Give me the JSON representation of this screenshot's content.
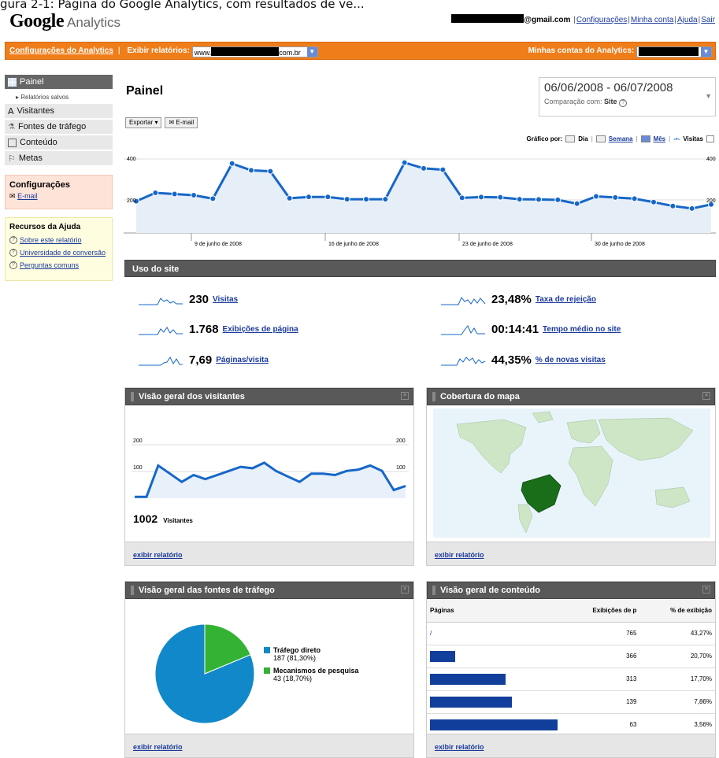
{
  "caption": "gura 2-1: Página do Google Analytics, com resultados de ve...",
  "logo": {
    "google": "Google",
    "analytics": "Analytics"
  },
  "toplinks": {
    "email_suffix": "@gmail.com",
    "settings": "Configurações",
    "account": "Minha conta",
    "help": "Ajuda",
    "logout": "Sair"
  },
  "orangebar": {
    "settings_link": "Configurações do Analytics",
    "reports_label": "Exibir relatórios:",
    "site_prefix": "www.",
    "site_suffix": "com.br",
    "accounts_label": "Minhas contas do Analytics:"
  },
  "sidebar": {
    "active": "Painel",
    "saved": "▸ Relatórios salvos",
    "items": [
      "Visitantes",
      "Fontes de tráfego",
      "Conteúdo",
      "Metas"
    ],
    "config_title": "Configurações",
    "config_email": "E-mail",
    "help_title": "Recursos da Ajuda",
    "help_items": [
      "Sobre este relatório",
      "Universidade de conversão",
      "Perguntas comuns"
    ]
  },
  "header": {
    "title": "Painel",
    "date_range": "06/06/2008 - 06/07/2008",
    "compare_label": "Comparação com:",
    "compare_value": "Site",
    "export_button": "Exportar ▾",
    "email_button": "E-mail"
  },
  "graph_by": {
    "label": "Gráfico por:",
    "day": "Dia",
    "week": "Semana",
    "month": "Mês",
    "metric": "Visitas"
  },
  "main_chart": {
    "ylabels": [
      "400",
      "200"
    ],
    "xlabels": [
      "9 de junho de 2008",
      "16 de junho de 2008",
      "23 de junho de 2008",
      "30 de junho de 2008"
    ]
  },
  "site_usage": {
    "title": "Uso do site",
    "metrics": [
      {
        "value": "230",
        "label": "Visitas"
      },
      {
        "value": "1.768",
        "label": "Exibições de página"
      },
      {
        "value": "7,69",
        "label": "Páginas/visita"
      },
      {
        "value": "23,48%",
        "label": "Taxa de rejeição"
      },
      {
        "value": "00:14:41",
        "label": "Tempo médio no site"
      },
      {
        "value": "44,35%",
        "label": "% de novas visitas"
      }
    ]
  },
  "visitors_panel": {
    "title": "Visão geral dos visitantes",
    "ylabels": [
      "200",
      "100"
    ],
    "total": "1002",
    "total_label": "Visitantes",
    "footer": "exibir relatório"
  },
  "map_panel": {
    "title": "Cobertura do mapa",
    "footer": "exibir relatório"
  },
  "traffic_panel": {
    "title": "Visão geral das fontes de tráfego",
    "footer": "exibir relatório",
    "legend": [
      {
        "name": "Tráfego direto",
        "detail": "187 (81,30%)",
        "color": "#1188c9"
      },
      {
        "name": "Mecanismos de pesquisa",
        "detail": "43 (18,70%)",
        "color": "#34b233"
      }
    ]
  },
  "content_panel": {
    "title": "Visão geral de conteúdo",
    "headers": [
      "Páginas",
      "Exibições de p",
      "% de exibição"
    ],
    "rows": [
      {
        "page": "/",
        "views": "765",
        "pct": "43,27%",
        "bar": 0
      },
      {
        "page": "",
        "views": "366",
        "pct": "20,70%",
        "bar": 0.2
      },
      {
        "page": "",
        "views": "313",
        "pct": "17,70%",
        "bar": 0.59
      },
      {
        "page": "",
        "views": "139",
        "pct": "7,86%",
        "bar": 0.64
      },
      {
        "page": "",
        "views": "63",
        "pct": "3,56%",
        "bar": 1.0
      }
    ],
    "footer": "exibir relatório"
  },
  "colors": {
    "orange": "#ef7d1a",
    "series": "#1667c8",
    "bar_dark": "#595959",
    "map_country": "#1a6e1a"
  },
  "chart_data": [
    {
      "type": "area",
      "ylim": [
        0,
        400
      ],
      "ylabels": [
        "400",
        "200"
      ],
      "x": [
        "06/06",
        "07/06",
        "08/06",
        "09/06",
        "10/06",
        "11/06",
        "12/06",
        "13/06",
        "14/06",
        "15/06",
        "16/06",
        "17/06",
        "18/06",
        "19/06",
        "20/06",
        "21/06",
        "22/06",
        "23/06",
        "24/06",
        "25/06",
        "26/06",
        "27/06",
        "28/06",
        "29/06",
        "30/06",
        "01/07",
        "02/07",
        "03/07",
        "04/07",
        "05/07",
        "06/07"
      ],
      "values": [
        165,
        208,
        202,
        196,
        178,
        360,
        325,
        320,
        180,
        187,
        187,
        175,
        175,
        175,
        365,
        335,
        328,
        182,
        186,
        185,
        175,
        174,
        172,
        152,
        190,
        184,
        178,
        160,
        140,
        127,
        148
      ]
    },
    {
      "type": "line",
      "ylim": [
        0,
        225
      ],
      "ylabels": [
        "200",
        "100"
      ],
      "values": [
        5,
        5,
        120,
        90,
        60,
        85,
        70,
        85,
        100,
        115,
        110,
        130,
        100,
        80,
        60,
        90,
        90,
        85,
        100,
        105,
        120,
        100,
        30,
        45
      ]
    },
    {
      "type": "pie",
      "categories": [
        "Tráfego direto",
        "Mecanismos de pesquisa"
      ],
      "values": [
        187,
        43
      ]
    }
  ]
}
